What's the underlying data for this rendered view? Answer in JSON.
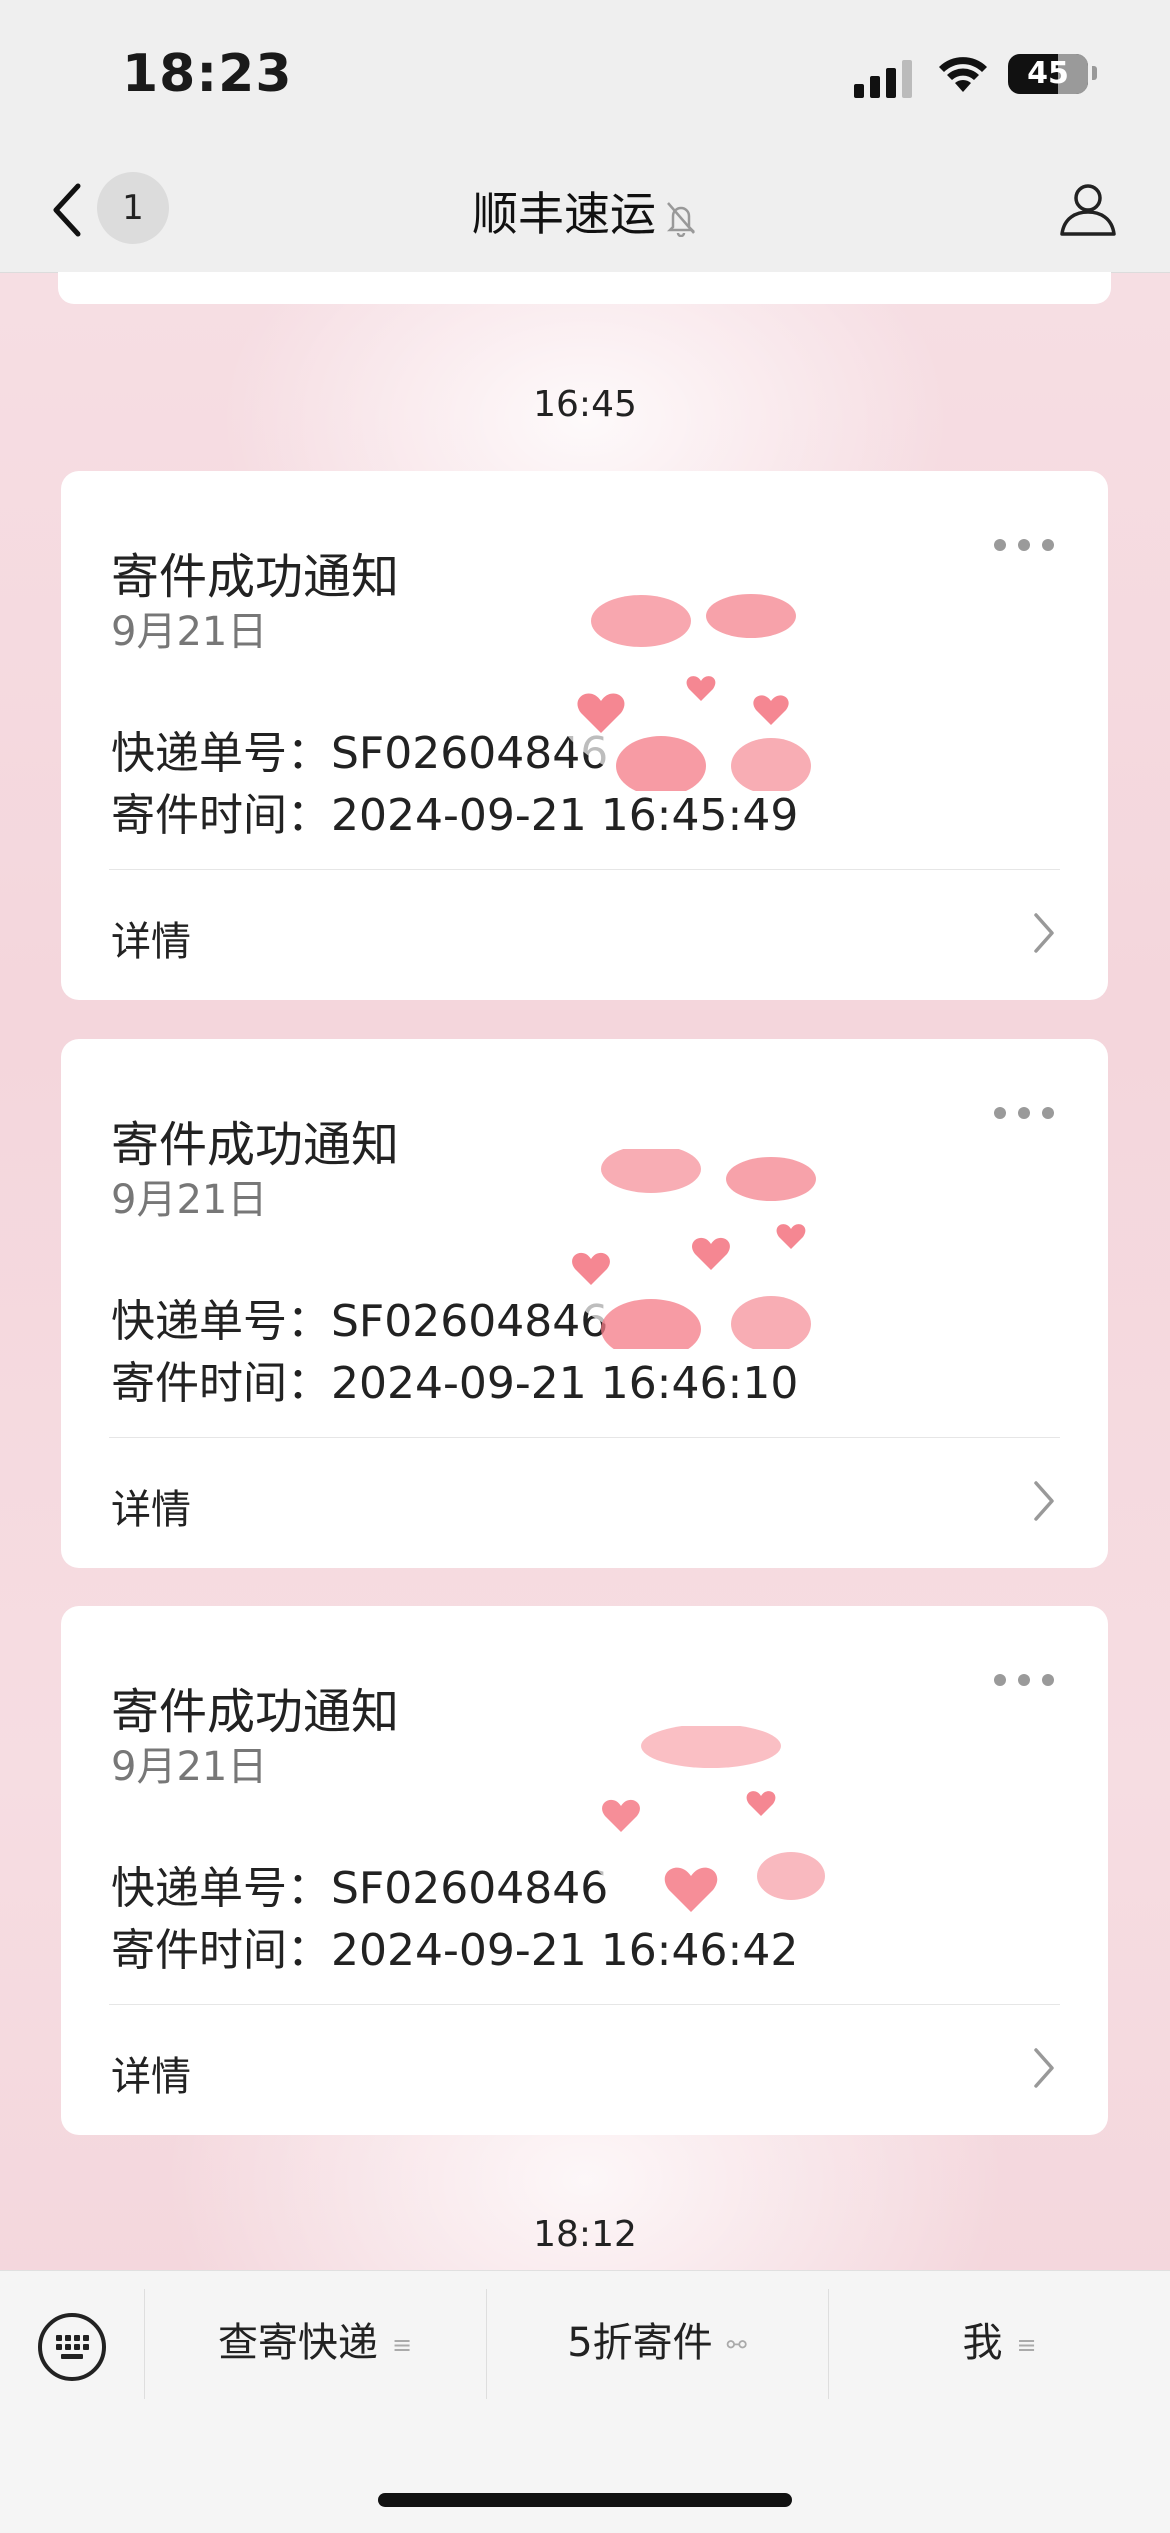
{
  "status_bar": {
    "time": "18:23",
    "battery": "45"
  },
  "nav": {
    "back_count": "1",
    "title": "顺丰速运",
    "mute_icon": "bell-slash-icon",
    "profile_icon": "person-icon"
  },
  "timestamps": {
    "first": "16:45",
    "last": "18:12"
  },
  "cards": [
    {
      "heading": "寄件成功通知",
      "date": "9月21日",
      "tracking_label": "快递单号：",
      "tracking_value": "SF02604846",
      "time_label": "寄件时间：",
      "time_value": "2024-09-21 16:45:49",
      "detail": "详情"
    },
    {
      "heading": "寄件成功通知",
      "date": "9月21日",
      "tracking_label": "快递单号：",
      "tracking_value": "SF02604846",
      "time_label": "寄件时间：",
      "time_value": "2024-09-21 16:46:10",
      "detail": "详情"
    },
    {
      "heading": "寄件成功通知",
      "date": "9月21日",
      "tracking_label": "快递单号：",
      "tracking_value": "SF02604846",
      "time_label": "寄件时间：",
      "time_value": "2024-09-21 16:46:42",
      "detail": "详情"
    }
  ],
  "menu": {
    "item1": "查寄快递",
    "item2": "5折寄件",
    "item3": "我"
  },
  "colors": {
    "background": "#f6dde2",
    "heart": "#f47a86",
    "card": "#ffffff"
  }
}
